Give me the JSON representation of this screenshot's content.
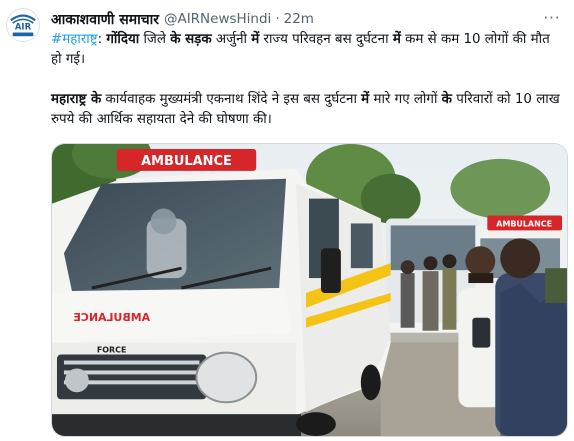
{
  "author": {
    "display_name": "आकाशवाणी समाचार",
    "handle": "@AIRNewsHindi",
    "separator": "·",
    "time": "22m",
    "avatar_icon": "air-logo-icon"
  },
  "menu": {
    "more_label": "···"
  },
  "tweet": {
    "line1": {
      "hashtag": "#महाराष्ट्र",
      "t1": ": ",
      "b1": "गोंदिया",
      "t2": " जिले ",
      "b2": "के सड़क",
      "t3": " अर्जुनी ",
      "b3": "में",
      "t4": " राज्य परिवहन बस दुर्घटना ",
      "b4": "में",
      "t5": " कम से कम 10 लोगों की मौत हो गई।"
    },
    "line2": {
      "b1": "महाराष्ट्र के",
      "t1": " कार्यवाहक मुख्यमंत्री एकनाथ शिंदे ने इस बस दुर्घटना ",
      "b2": "में",
      "t2": " मारे गए लोगों ",
      "b3": "के",
      "t3": " परिवारों को 10 लाख रुपये की आर्थिक सहायता देने की घोषणा की।"
    }
  },
  "media": {
    "ambulance_label": "AMBULANCE",
    "ambulance_side_text": "AMBULANCE",
    "bus_sign": "AMBULANCE",
    "brand_emblem": "FORCE"
  },
  "colors": {
    "link": "#1d9bf0",
    "text": "#0f1419",
    "secondary": "#536471",
    "ambulance_red": "#d7262a"
  }
}
